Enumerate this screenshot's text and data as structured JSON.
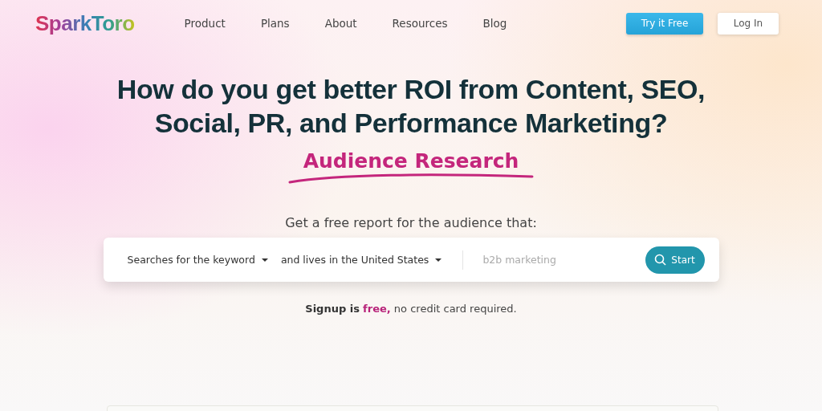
{
  "logo": "SparkToro",
  "nav": [
    {
      "label": "Product"
    },
    {
      "label": "Plans"
    },
    {
      "label": "About"
    },
    {
      "label": "Resources"
    },
    {
      "label": "Blog"
    }
  ],
  "actions": {
    "primary": "Try it Free",
    "secondary": "Log In"
  },
  "headline": "How do you get better ROI from Content, SEO, Social, PR, and Performance Marketing?",
  "tagline": "Audience Research",
  "prompt": "Get a free report for the audience that:",
  "search": {
    "criteria": "Searches for the keyword",
    "location": "and lives in the United States",
    "placeholder": "b2b marketing",
    "button": "Start"
  },
  "signup": {
    "lead": "Signup is",
    "highlight": "free,",
    "rest": "no credit card required."
  }
}
